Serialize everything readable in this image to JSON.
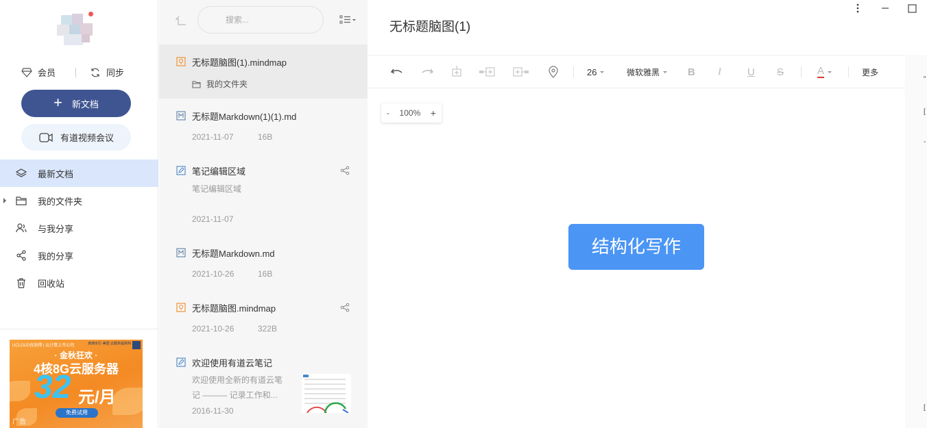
{
  "account": {
    "vip_label": "会员",
    "sync_label": "同步"
  },
  "sidebar": {
    "new_doc_label": "新文档",
    "meeting_label": "有道视频会议",
    "items": [
      {
        "label": "最新文档"
      },
      {
        "label": "我的文件夹"
      },
      {
        "label": "与我分享"
      },
      {
        "label": "我的分享"
      },
      {
        "label": "回收站"
      }
    ]
  },
  "ad": {
    "top_text": "UCLOUD优刻得 | 云计算上市公司",
    "corner_text": "滴滴出行·美团 云服务提供商",
    "line1": "· 金秋狂欢 ·",
    "line2": "4核8G云服务器",
    "price": "32",
    "unit": "元/月",
    "button": "免费试用",
    "label": "广告"
  },
  "list": {
    "search_placeholder": "搜索...",
    "docs": [
      {
        "title": "无标题脑图(1).mindmap",
        "folder": "我的文件夹"
      },
      {
        "title": "无标题Markdown(1)(1).md",
        "date": "2021-11-07",
        "size": "16B"
      },
      {
        "title": "笔记编辑区域",
        "excerpt": "笔记编辑区域",
        "date": "2021-11-07"
      },
      {
        "title": "无标题Markdown.md",
        "date": "2021-10-26",
        "size": "16B"
      },
      {
        "title": "无标题脑图.mindmap",
        "date": "2021-10-26",
        "size": "322B"
      },
      {
        "title": "欢迎使用有道云笔记",
        "excerpt_line1": "欢迎使用全新的有道云笔",
        "excerpt_line2": "记 ——— 记录工作和...",
        "date": "2016-11-30"
      }
    ]
  },
  "editor": {
    "title": "无标题脑图(1)",
    "font_size": "26",
    "font_family": "微软雅黑",
    "bold": "B",
    "italic": "I",
    "underline": "U",
    "strike": "S",
    "color": "A",
    "more_label": "更多",
    "zoom_minus": "-",
    "zoom_value": "100%",
    "zoom_plus": "+",
    "node_text": "结构化写作"
  },
  "colors": {
    "accent": "#3f5592",
    "node": "#4b95f5",
    "active_nav": "#d9e6fb",
    "text_color_bar": "#e03535"
  }
}
